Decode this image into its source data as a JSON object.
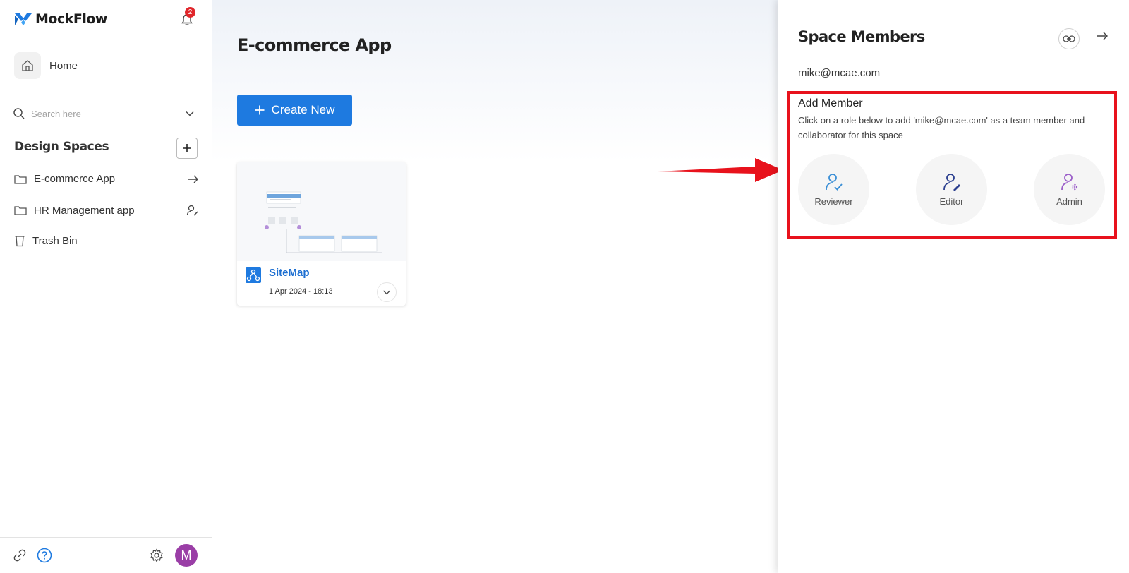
{
  "sidebar": {
    "brand": "MockFlow",
    "notification_count": "2",
    "home_label": "Home",
    "search_placeholder": "Search here",
    "spaces_title": "Design Spaces",
    "items": [
      {
        "label": "E-commerce App",
        "icon": "folder-icon",
        "trail_icon": "arrow-right-icon"
      },
      {
        "label": "HR Management app",
        "icon": "folder-icon",
        "trail_icon": "user-edit-icon"
      },
      {
        "label": "Trash Bin",
        "icon": "trash-icon"
      }
    ],
    "avatar_initial": "M"
  },
  "main": {
    "title": "E-commerce App",
    "create_label": "Create New",
    "card": {
      "title": "SiteMap",
      "date": "1 Apr 2024 - 18:13"
    }
  },
  "panel": {
    "title": "Space Members",
    "email_value": "mike@mcae.com",
    "add_title": "Add Member",
    "add_desc": "Click on a role below to add 'mike@mcae.com' as a team member and collaborator for this space",
    "roles": [
      {
        "label": "Reviewer",
        "color": "#3b8fd6",
        "icon": "reviewer-icon"
      },
      {
        "label": "Editor",
        "color": "#2b3f8f",
        "icon": "editor-icon"
      },
      {
        "label": "Admin",
        "color": "#9b5ec9",
        "icon": "admin-icon"
      }
    ]
  },
  "colors": {
    "primary": "#1e7ae0",
    "highlight": "#e8121c",
    "avatar": "#9a3ea6",
    "badge": "#e0262b"
  }
}
